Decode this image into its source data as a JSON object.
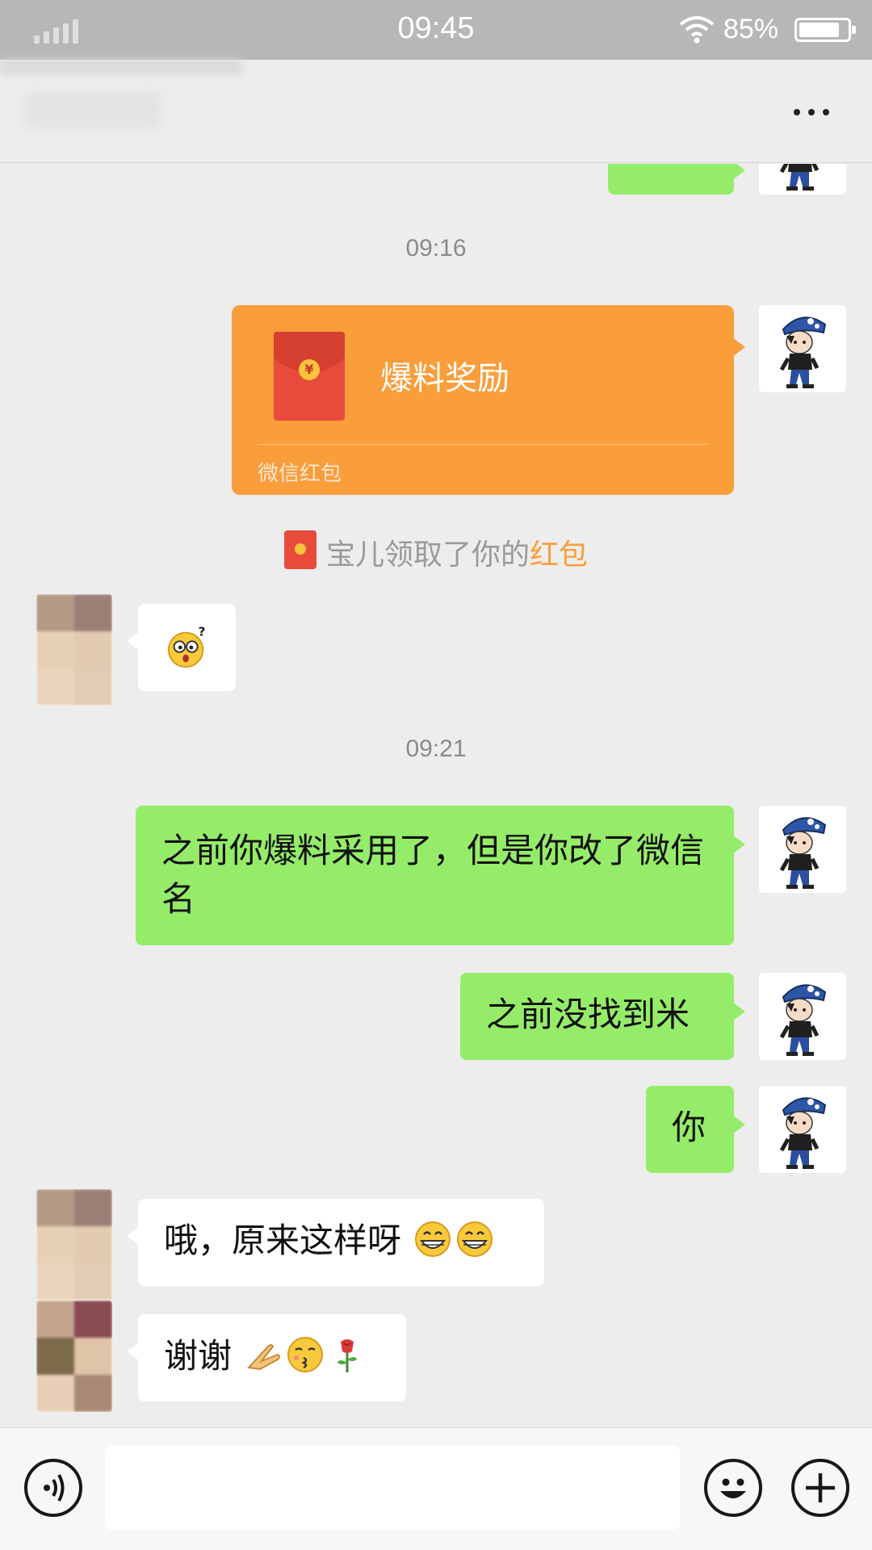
{
  "status_bar": {
    "time": "09:45",
    "battery_percent": "85%",
    "battery_level": 0.85
  },
  "nav": {
    "more_icon": "more-dots-icon"
  },
  "chat": {
    "timestamps": [
      "09:16",
      "09:21"
    ],
    "red_packet": {
      "title": "爆料奖励",
      "brand": "微信红包",
      "coin_symbol": "¥"
    },
    "system_note": {
      "text": "宝儿领取了你的",
      "highlight": "红包"
    },
    "messages": [
      {
        "from": "me",
        "text": "之前你爆料采用了，但是你改了微信名"
      },
      {
        "from": "me",
        "text": "之前没找到米"
      },
      {
        "from": "me",
        "text": "你"
      },
      {
        "from": "them",
        "text": "哦，原来这样呀"
      },
      {
        "from": "them",
        "text": "谢谢"
      }
    ]
  },
  "input_bar": {
    "voice_icon": "voice-icon",
    "emoji_icon": "emoji-icon",
    "plus_icon": "plus-icon"
  },
  "colors": {
    "bubble_me": "#95ec69",
    "bubble_them": "#ffffff",
    "red_packet": "#fa9d3b",
    "background": "#ededed"
  }
}
